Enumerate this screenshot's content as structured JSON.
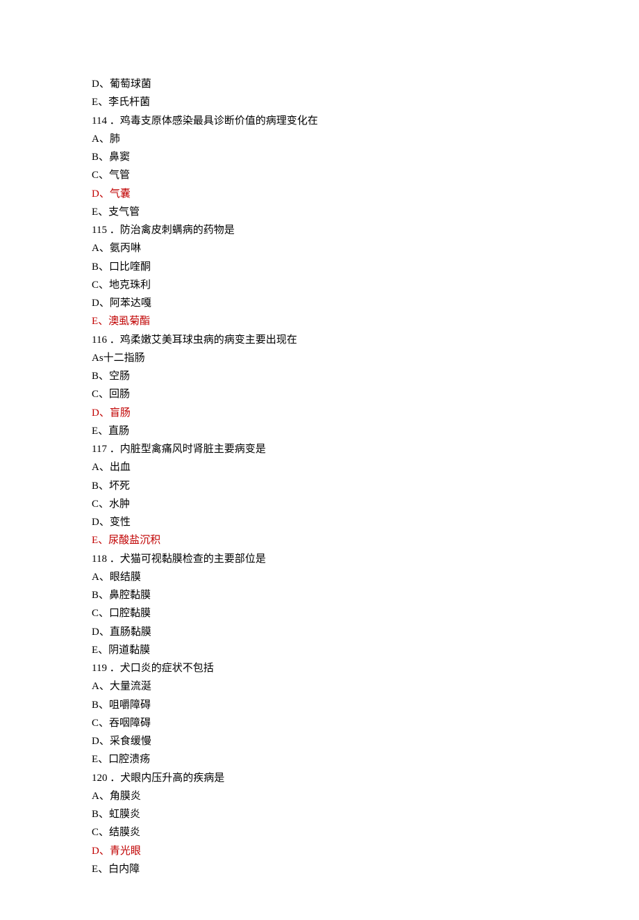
{
  "lines": [
    {
      "text": "D、葡萄球菌",
      "red": false
    },
    {
      "text": "E、李氏杆菌",
      "red": false
    },
    {
      "text": "114 ．鸡毒支原体感染最具诊断价值的病理变化在",
      "red": false
    },
    {
      "text": "A、肺",
      "red": false
    },
    {
      "text": "B、鼻窦",
      "red": false
    },
    {
      "text": "C、气管",
      "red": false
    },
    {
      "text": "D、气囊",
      "red": true
    },
    {
      "text": "E、支气管",
      "red": false
    },
    {
      "text": "115 ．防治禽皮刺螨病的药物是",
      "red": false
    },
    {
      "text": "A、氨丙啉",
      "red": false
    },
    {
      "text": "B、口比喹酮",
      "red": false
    },
    {
      "text": "C、地克珠利",
      "red": false
    },
    {
      "text": "D、阿苯达嘎",
      "red": false
    },
    {
      "text": "E、澳虱菊酯",
      "red": true
    },
    {
      "text": "116 ．鸡柔嫩艾美耳球虫病的病变主要出现在",
      "red": false
    },
    {
      "text": "As十二指肠",
      "red": false
    },
    {
      "text": "B、空肠",
      "red": false
    },
    {
      "text": "C、回肠",
      "red": false
    },
    {
      "text": "D、盲肠",
      "red": true
    },
    {
      "text": "E、直肠",
      "red": false
    },
    {
      "text": "117 ．内脏型禽痛风时肾脏主要病变是",
      "red": false
    },
    {
      "text": "A、出血",
      "red": false
    },
    {
      "text": "B、坏死",
      "red": false
    },
    {
      "text": "C、水肿",
      "red": false
    },
    {
      "text": "D、变性",
      "red": false
    },
    {
      "text": "E、尿酸盐沉积",
      "red": true
    },
    {
      "text": "118 ．犬猫可视黏膜检查的主要部位是",
      "red": false
    },
    {
      "text": "A、眼结膜",
      "red": false
    },
    {
      "text": "B、鼻腔黏膜",
      "red": false
    },
    {
      "text": "C、口腔黏膜",
      "red": false
    },
    {
      "text": "D、直肠黏膜",
      "red": false
    },
    {
      "text": "E、阴道黏膜",
      "red": false
    },
    {
      "text": "119 ．犬口炎的症状不包括",
      "red": false
    },
    {
      "text": "A、大量流涎",
      "red": false
    },
    {
      "text": "B、咀嚼障碍",
      "red": false
    },
    {
      "text": "C、吞咽障碍",
      "red": false
    },
    {
      "text": "D、采食缓慢",
      "red": false
    },
    {
      "text": "E、口腔溃疡",
      "red": false
    },
    {
      "text": "120 ．犬眼内压升高的疾病是",
      "red": false
    },
    {
      "text": "A、角膜炎",
      "red": false
    },
    {
      "text": "B、虹膜炎",
      "red": false
    },
    {
      "text": "C、结膜炎",
      "red": false
    },
    {
      "text": "D、青光眼",
      "red": true
    },
    {
      "text": "E、白内障",
      "red": false
    }
  ]
}
